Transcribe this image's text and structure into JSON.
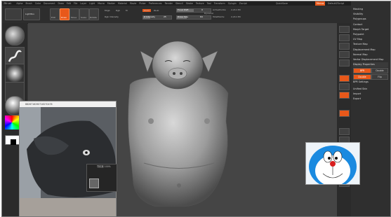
{
  "menubar": {
    "title": "ZBrush",
    "items": [
      "Alpha",
      "Brush",
      "Color",
      "Document",
      "Draw",
      "Edit",
      "File",
      "Layer",
      "Light",
      "Macro",
      "Marker",
      "Material",
      "Movie",
      "Picker",
      "Preferences",
      "Render",
      "Stencil",
      "Stroke",
      "Texture",
      "Tool",
      "Transform",
      "Zplugin",
      "Zscript"
    ],
    "quicksave": "QuickSave",
    "default_script": "DefaultZScript"
  },
  "toolbar": {
    "lightbox": "LightBox",
    "buttons": [
      "Edit",
      "Draw",
      "Move",
      "Scale",
      "Rotate"
    ],
    "mrgb": "Mrgb",
    "rgb": "Rgb",
    "m": "M",
    "zadd": "Zadd",
    "zsub": "Zsub",
    "focal_shift_label": "Focal Shift",
    "focal_shift_value": "0",
    "draw_size_label": "Draw Size",
    "draw_size_value": "64",
    "z_intensity_label": "Z Intensity",
    "z_intensity_value": "25",
    "rgb_intensity_label": "Rgb Intensity",
    "active_points_label": "ActivePoints:",
    "active_points_value": "2,211 Mil",
    "total_points_label": "TotalPoints:",
    "total_points_value": "2,211 Mil",
    "dynamic": "Dynamic"
  },
  "right_panel": {
    "items": [
      "Masking",
      "Visibility",
      "Polygroups",
      "Contact",
      "Morph Target",
      "Polypaint",
      "UV Map",
      "Texture Map",
      "Displacement Map",
      "Normal Map",
      "Vector Displacement Map",
      "Display Properties"
    ],
    "bpr_label": "BPR",
    "double_label": "Double",
    "flip_label": "Flip",
    "bpr_settings": "BPR Settings",
    "unified_skin": "Unified Skin",
    "import": "Import",
    "export": "Export"
  },
  "reference_window": {
    "title": "8826716290718270476"
  },
  "navigator": {
    "title": "导航器 100%"
  }
}
